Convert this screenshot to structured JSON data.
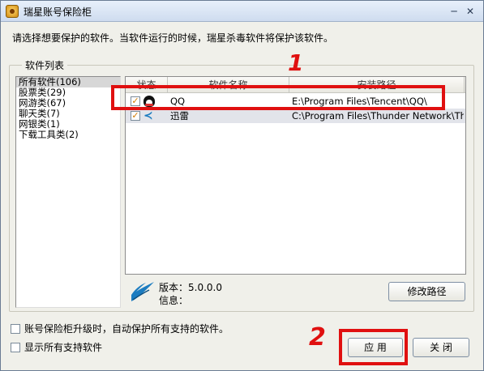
{
  "window": {
    "title": "瑞星账号保险柜",
    "minimize": "─",
    "close": "✕",
    "icon": "shield-app-icon"
  },
  "description": "请选择想要保护的软件。当软件运行的时候，瑞星杀毒软件将保护该软件。",
  "group_title": "软件列表",
  "categories": [
    {
      "label": "所有软件(106)",
      "selected": true
    },
    {
      "label": "股票类(29)"
    },
    {
      "label": "网游类(67)"
    },
    {
      "label": "聊天类(7)"
    },
    {
      "label": "网银类(1)"
    },
    {
      "label": "下载工具类(2)"
    }
  ],
  "table": {
    "columns": [
      "状态",
      "软件名称",
      "安装路径"
    ],
    "rows": [
      {
        "checked": true,
        "icon": "qq-icon",
        "name": "QQ",
        "path": "E:\\Program Files\\Tencent\\QQ\\"
      },
      {
        "checked": true,
        "icon": "thunder-icon",
        "name": "迅雷",
        "path": "C:\\Program Files\\Thunder Network\\Thun..."
      }
    ]
  },
  "version_label": "版本：5.0.0.0",
  "info_label": "信息：",
  "buttons": {
    "modify_path": "修改路径",
    "apply": "应 用",
    "close": "关 闭"
  },
  "options": {
    "auto_protect": "账号保险柜升级时，自动保护所有支持的软件。",
    "show_all": "显示所有支持软件"
  },
  "annotations": {
    "mark1": "1",
    "mark2": "2",
    "color": "#e01010"
  }
}
